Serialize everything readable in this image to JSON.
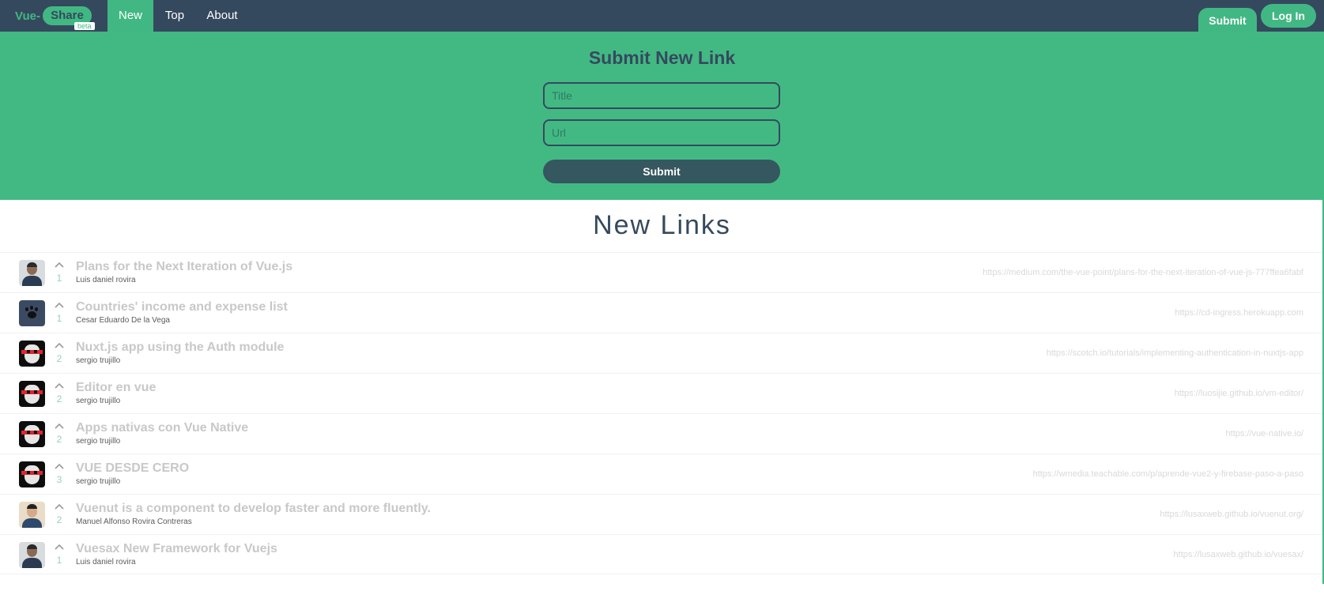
{
  "brand": {
    "prefix": "Vue-",
    "name": "Share",
    "badge": "beta"
  },
  "nav": {
    "items": [
      {
        "label": "New"
      },
      {
        "label": "Top"
      },
      {
        "label": "About"
      }
    ],
    "submit_label": "Submit",
    "login_label": "Log In"
  },
  "form": {
    "heading": "Submit New Link",
    "title_placeholder": "Title",
    "url_placeholder": "Url",
    "submit_label": "Submit"
  },
  "colors": {
    "nav_bg": "#35495e",
    "accent": "#41b883",
    "hero_bg": "#42b983",
    "button_dark": "#35575f"
  },
  "links": {
    "heading": "New Links",
    "items": [
      {
        "title": "Plans for the Next Iteration of Vue.js",
        "author": "Luis daniel rovira",
        "votes": "1",
        "url": "https://medium.com/the-vue-point/plans-for-the-next-iteration-of-vue-js-777ffea6fabf",
        "avatar": "man-avatar"
      },
      {
        "title": "Countries' income and expense list",
        "author": "Cesar Eduardo De la Vega",
        "votes": "1",
        "url": "https://cd-ingress.herokuapp.com",
        "avatar": "paw-avatar"
      },
      {
        "title": "Nuxt.js app using the Auth module",
        "author": "sergio trujillo",
        "votes": "2",
        "url": "https://scotch.io/tutorials/implementing-authentication-in-nuxtjs-app",
        "avatar": "mask-avatar"
      },
      {
        "title": "Editor en vue",
        "author": "sergio trujillo",
        "votes": "2",
        "url": "https://luosijie.github.io/vm-editor/",
        "avatar": "mask-avatar"
      },
      {
        "title": "Apps nativas con Vue Native",
        "author": "sergio trujillo",
        "votes": "2",
        "url": "https://vue-native.io/",
        "avatar": "mask-avatar"
      },
      {
        "title": "VUE DESDE CERO",
        "author": "sergio trujillo",
        "votes": "3",
        "url": "https://wmedia.teachable.com/p/aprende-vue2-y-firebase-paso-a-paso",
        "avatar": "mask-avatar"
      },
      {
        "title": "Vuenut is a component to develop faster and more fluently.",
        "author": "Manuel Alfonso Rovira Contreras",
        "votes": "2",
        "url": "https://lusaxweb.github.io/vuenut.org/",
        "avatar": "man-avatar-light"
      },
      {
        "title": "Vuesax New Framework for Vuejs",
        "author": "Luis daniel rovira",
        "votes": "1",
        "url": "https://lusaxweb.github.io/vuesax/",
        "avatar": "man-avatar"
      }
    ]
  }
}
